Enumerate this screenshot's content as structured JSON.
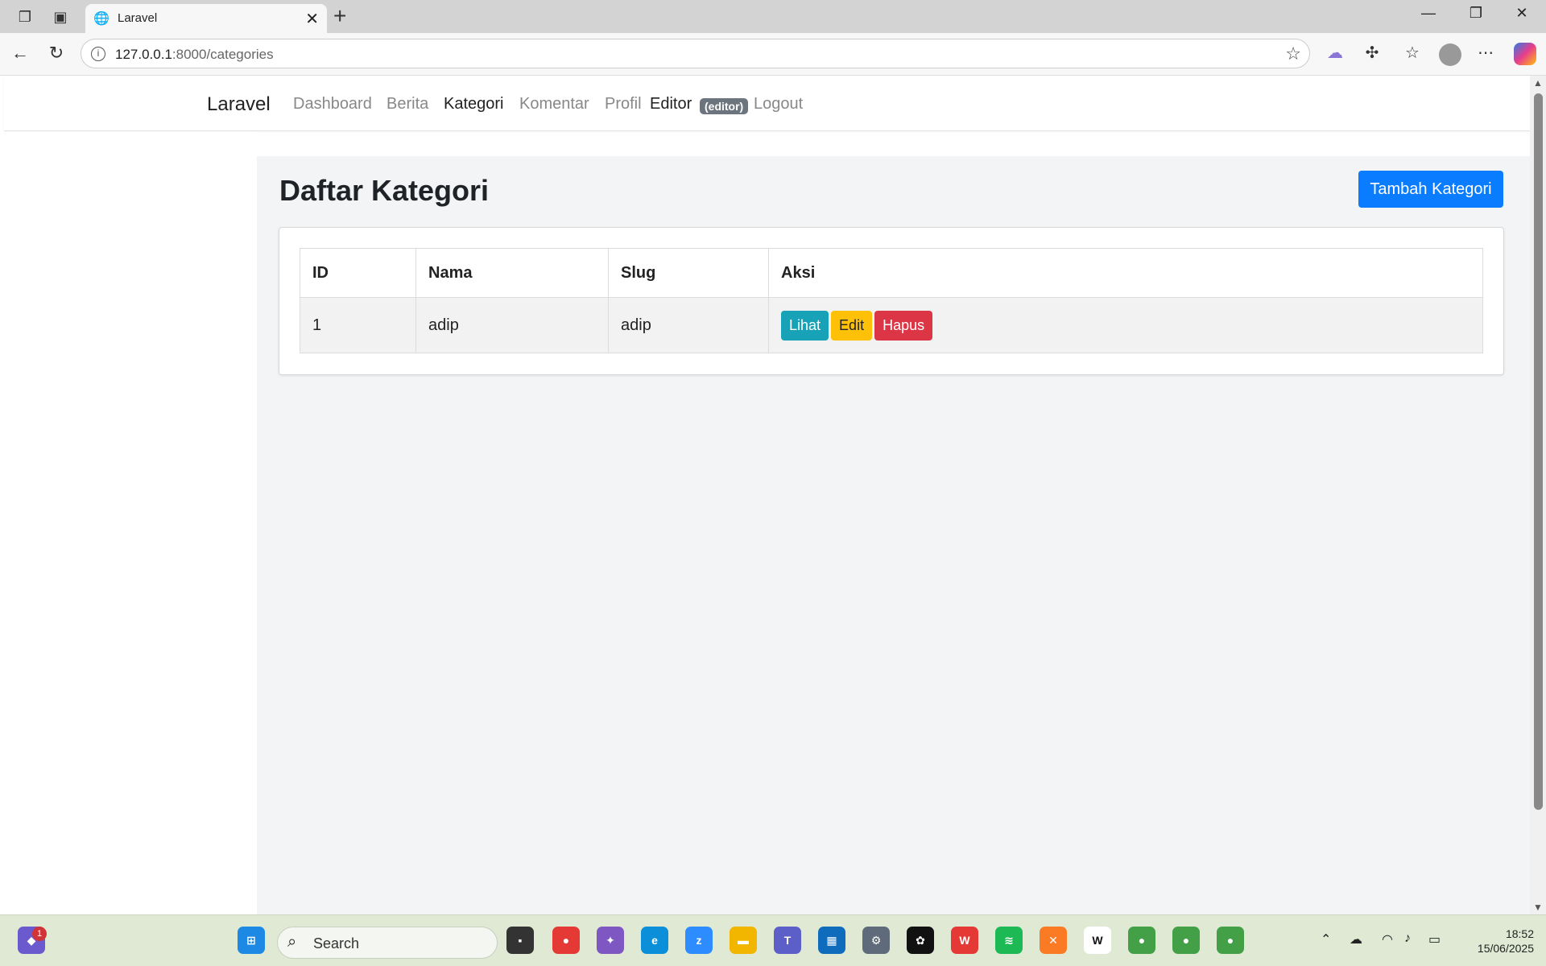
{
  "browser": {
    "tab_title": "Laravel",
    "url_host": "127.0.0.1",
    "url_rest": ":8000/categories"
  },
  "navbar": {
    "brand": "Laravel",
    "links": [
      {
        "label": "Dashboard",
        "active": false
      },
      {
        "label": "Berita",
        "active": false
      },
      {
        "label": "Kategori",
        "active": true
      },
      {
        "label": "Komentar",
        "active": false
      },
      {
        "label": "Profil",
        "active": false
      }
    ],
    "user_name": "Editor",
    "user_role": "(editor)",
    "logout_label": "Logout"
  },
  "main": {
    "title": "Daftar Kategori",
    "add_button": "Tambah Kategori",
    "table": {
      "columns": [
        "ID",
        "Nama",
        "Slug",
        "Aksi"
      ],
      "rows": [
        {
          "id": "1",
          "nama": "adip",
          "slug": "adip"
        }
      ],
      "actions": {
        "view": "Lihat",
        "edit": "Edit",
        "delete": "Hapus"
      }
    }
  },
  "taskbar": {
    "search_placeholder": "Search",
    "notification_count": "1",
    "time": "18:52",
    "date": "15/06/2025"
  },
  "colors": {
    "primary": "#0a7cff",
    "info": "#17a2b8",
    "warning": "#ffc107",
    "danger": "#dc3545",
    "badge": "#6c757d"
  }
}
